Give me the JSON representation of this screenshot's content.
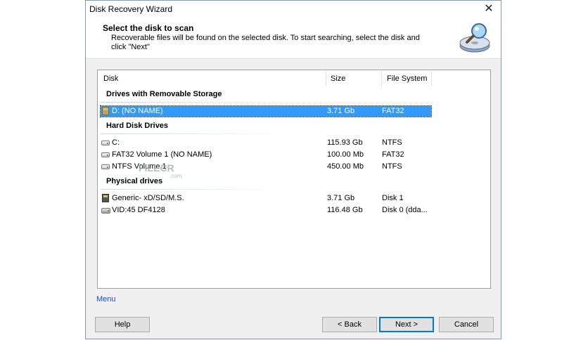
{
  "window": {
    "title": "Disk Recovery Wizard",
    "close_glyph": "✕"
  },
  "header": {
    "title": "Select the disk to scan",
    "description": "Recoverable files will be found on the selected disk. To start searching, select the disk and click \"Next\""
  },
  "columns": {
    "disk": "Disk",
    "size": "Size",
    "file_system": "File System"
  },
  "groups": [
    {
      "label": "Drives with Removable Storage",
      "items": [
        {
          "name": "D: (NO NAME)",
          "size": "3.71 Gb",
          "fs": "FAT32",
          "icon": "sd-card-icon",
          "selected": true
        }
      ]
    },
    {
      "label": "Hard Disk Drives",
      "items": [
        {
          "name": "C:",
          "size": "115.93 Gb",
          "fs": "NTFS",
          "icon": "hard-drive-icon"
        },
        {
          "name": "FAT32 Volume 1 (NO NAME)",
          "size": "100.00 Mb",
          "fs": "FAT32",
          "icon": "hard-drive-icon"
        },
        {
          "name": "NTFS Volume 1",
          "size": "450.00 Mb",
          "fs": "NTFS",
          "icon": "hard-drive-icon"
        }
      ]
    },
    {
      "label": "Physical drives",
      "items": [
        {
          "name": "Generic- xD/SD/M.S.",
          "size": "3.71 Gb",
          "fs": "Disk 1",
          "icon": "sd-card-icon"
        },
        {
          "name": "VID:45 DF4128",
          "size": "116.48 Gb",
          "fs": "Disk 0 (dda...",
          "icon": "hard-drive-icon"
        }
      ]
    }
  ],
  "watermark": {
    "text": "FILECR",
    "suffix": ".com"
  },
  "footer": {
    "menu_label": "Menu",
    "help_label": "Help",
    "back_label": "< Back",
    "next_label": "Next >",
    "cancel_label": "Cancel"
  },
  "colors": {
    "selection": "#3399ff",
    "link": "#1a4bd1",
    "default_button_border": "#0078d7"
  }
}
